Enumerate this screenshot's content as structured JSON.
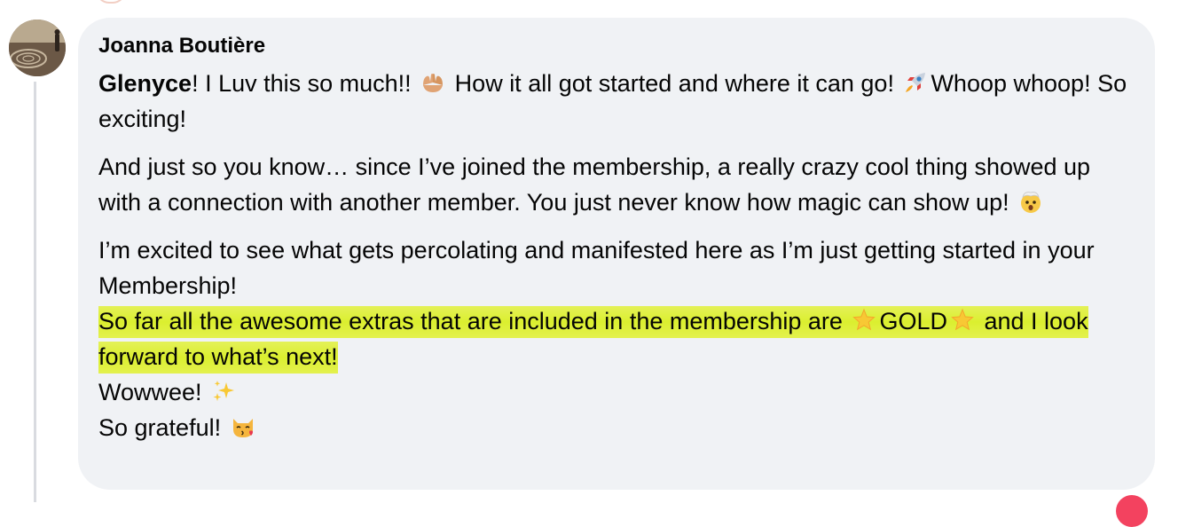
{
  "comment": {
    "author": "Joanna Boutière",
    "mention": "Glenyce",
    "p1": {
      "after_mention": "! I Luv this so much!! ",
      "mid": " How it all got started and where it can go! ",
      "end": "Whoop whoop! So exciting!"
    },
    "p2": {
      "text": "And just so you know… since I’ve joined the membership, a really crazy cool thing showed up with a connection with another member. You just never know how magic can show up! "
    },
    "p3": {
      "line1": "I’m excited to see what gets percolating and manifested here as I’m just getting started in your Membership!",
      "hl_start": "So far all the awesome extras that are included in the membership are ",
      "hl_gold": "GOLD",
      "hl_end": " and I look forward to what’s next!",
      "wowwee": "Wowwee! ",
      "grateful": "So grateful! "
    },
    "emojis": {
      "raising_hands": "raising-hands-icon",
      "rocket": "rocket-icon",
      "exploding_head": "exploding-head-icon",
      "star": "glowing-star-icon",
      "sparkles": "sparkles-icon",
      "kissing_cat": "kissing-cat-icon"
    },
    "colors": {
      "bubble_bg": "#f0f2f5",
      "highlight": "#dbef2f",
      "text": "#050505"
    }
  }
}
